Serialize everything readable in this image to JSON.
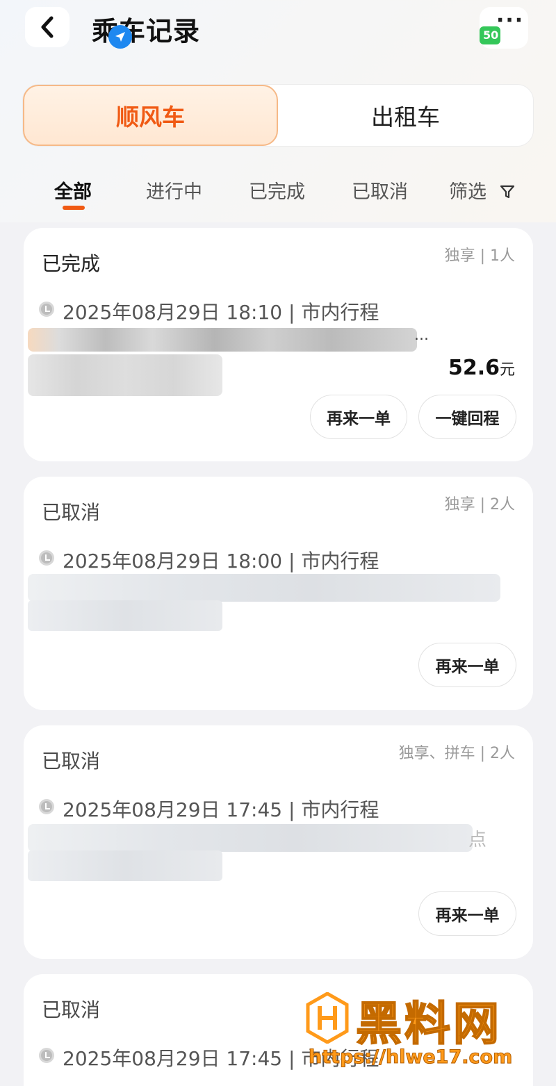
{
  "header": {
    "title": "乘车记录",
    "badge_text": "50",
    "more_label": "···"
  },
  "segments": [
    {
      "label": "顺风车",
      "active": true
    },
    {
      "label": "出租车",
      "active": false
    }
  ],
  "filter_tabs": [
    {
      "label": "全部",
      "active": true
    },
    {
      "label": "进行中"
    },
    {
      "label": "已完成"
    },
    {
      "label": "已取消"
    },
    {
      "label": "筛选"
    }
  ],
  "orders": [
    {
      "status": "已完成",
      "meta": "独享 | 1人",
      "time": "2025年08月29日 18:10 | 市内行程",
      "address_tail": "...",
      "price": "52.6",
      "currency": "元",
      "buttons": [
        "再来一单",
        "一键回程"
      ]
    },
    {
      "status": "已取消",
      "meta": "独享 | 2人",
      "time": "2025年08月29日 18:00 | 市内行程",
      "buttons": [
        "再来一单"
      ]
    },
    {
      "status": "已取消",
      "meta": "独享、拼车 | 2人",
      "time": "2025年08月29日 17:45 | 市内行程",
      "address_tail": "点",
      "buttons": [
        "再来一单"
      ]
    },
    {
      "status": "已取消",
      "time": "2025年08月29日 17:45 | 市内行程"
    }
  ],
  "watermark": {
    "brand": "黑料网",
    "url": "https://hlwe17.com"
  },
  "colors": {
    "accent": "#f05a14",
    "nav_badge": "#1e88f0",
    "green_badge": "#34c759",
    "watermark": "#ff9a1a"
  }
}
